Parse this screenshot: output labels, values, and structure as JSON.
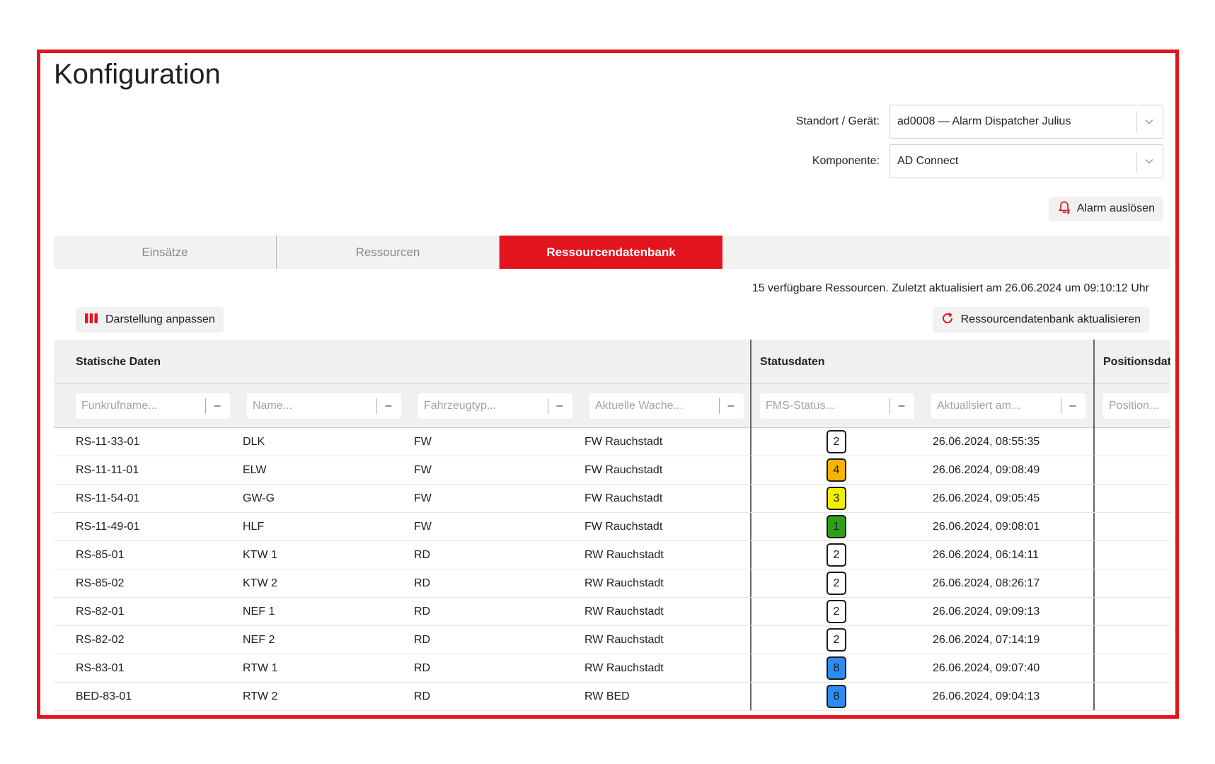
{
  "page": {
    "title": "Konfiguration"
  },
  "selectors": {
    "standort": {
      "label": "Standort / Gerät:",
      "value": "ad0008 — Alarm Dispatcher Julius"
    },
    "komponente": {
      "label": "Komponente:",
      "value": "AD Connect"
    }
  },
  "alarm_button": {
    "label": "Alarm auslösen",
    "icon": "bell-plus-icon"
  },
  "tabs": [
    {
      "label": "Einsätze",
      "active": false
    },
    {
      "label": "Ressourcen",
      "active": false
    },
    {
      "label": "Ressourcendatenbank",
      "active": true
    }
  ],
  "info_line": "15 verfügbare Ressourcen. Zuletzt aktualisiert am 26.06.2024 um 09:10:12 Uhr",
  "toolbar": {
    "customize_label": "Darstellung anpassen",
    "refresh_label": "Ressourcendatenbank aktualisieren"
  },
  "table": {
    "groups": {
      "static": "Statische Daten",
      "status": "Statusdaten",
      "position": "Positionsdat"
    },
    "filters": {
      "funkrufname": "Funkrufname...",
      "name": "Name...",
      "fahrzeugtyp": "Fahrzeugtyp...",
      "wache": "Aktuelle Wache...",
      "fms": "FMS-Status...",
      "aktualisiert": "Aktualisiert am...",
      "position": "Position..."
    },
    "filter_minus": "–",
    "rows": [
      {
        "funkrufname": "RS-11-33-01",
        "name": "DLK",
        "typ": "FW",
        "wache": "FW Rauchstadt",
        "fms": "2",
        "fms_color": "#ffffff",
        "aktualisiert": "26.06.2024, 08:55:35"
      },
      {
        "funkrufname": "RS-11-11-01",
        "name": "ELW",
        "typ": "FW",
        "wache": "FW Rauchstadt",
        "fms": "4",
        "fms_color": "#f5b400",
        "aktualisiert": "26.06.2024, 09:08:49"
      },
      {
        "funkrufname": "RS-11-54-01",
        "name": "GW-G",
        "typ": "FW",
        "wache": "FW Rauchstadt",
        "fms": "3",
        "fms_color": "#f3ef00",
        "aktualisiert": "26.06.2024, 09:05:45"
      },
      {
        "funkrufname": "RS-11-49-01",
        "name": "HLF",
        "typ": "FW",
        "wache": "FW Rauchstadt",
        "fms": "1",
        "fms_color": "#2ea017",
        "aktualisiert": "26.06.2024, 09:08:01"
      },
      {
        "funkrufname": "RS-85-01",
        "name": "KTW 1",
        "typ": "RD",
        "wache": "RW Rauchstadt",
        "fms": "2",
        "fms_color": "#ffffff",
        "aktualisiert": "26.06.2024, 06:14:11"
      },
      {
        "funkrufname": "RS-85-02",
        "name": "KTW 2",
        "typ": "RD",
        "wache": "RW Rauchstadt",
        "fms": "2",
        "fms_color": "#ffffff",
        "aktualisiert": "26.06.2024, 08:26:17"
      },
      {
        "funkrufname": "RS-82-01",
        "name": "NEF 1",
        "typ": "RD",
        "wache": "RW Rauchstadt",
        "fms": "2",
        "fms_color": "#ffffff",
        "aktualisiert": "26.06.2024, 09:09:13"
      },
      {
        "funkrufname": "RS-82-02",
        "name": "NEF 2",
        "typ": "RD",
        "wache": "RW Rauchstadt",
        "fms": "2",
        "fms_color": "#ffffff",
        "aktualisiert": "26.06.2024, 07:14:19"
      },
      {
        "funkrufname": "RS-83-01",
        "name": "RTW 1",
        "typ": "RD",
        "wache": "RW Rauchstadt",
        "fms": "8",
        "fms_color": "#2d8cf0",
        "aktualisiert": "26.06.2024, 09:07:40"
      },
      {
        "funkrufname": "BED-83-01",
        "name": "RTW 2",
        "typ": "RD",
        "wache": "RW BED",
        "fms": "8",
        "fms_color": "#2d8cf0",
        "aktualisiert": "26.06.2024, 09:04:13"
      }
    ]
  },
  "colors": {
    "accent": "#e2151f",
    "header_bg": "#f0f0f0",
    "button_bg": "#f1f1f1"
  }
}
